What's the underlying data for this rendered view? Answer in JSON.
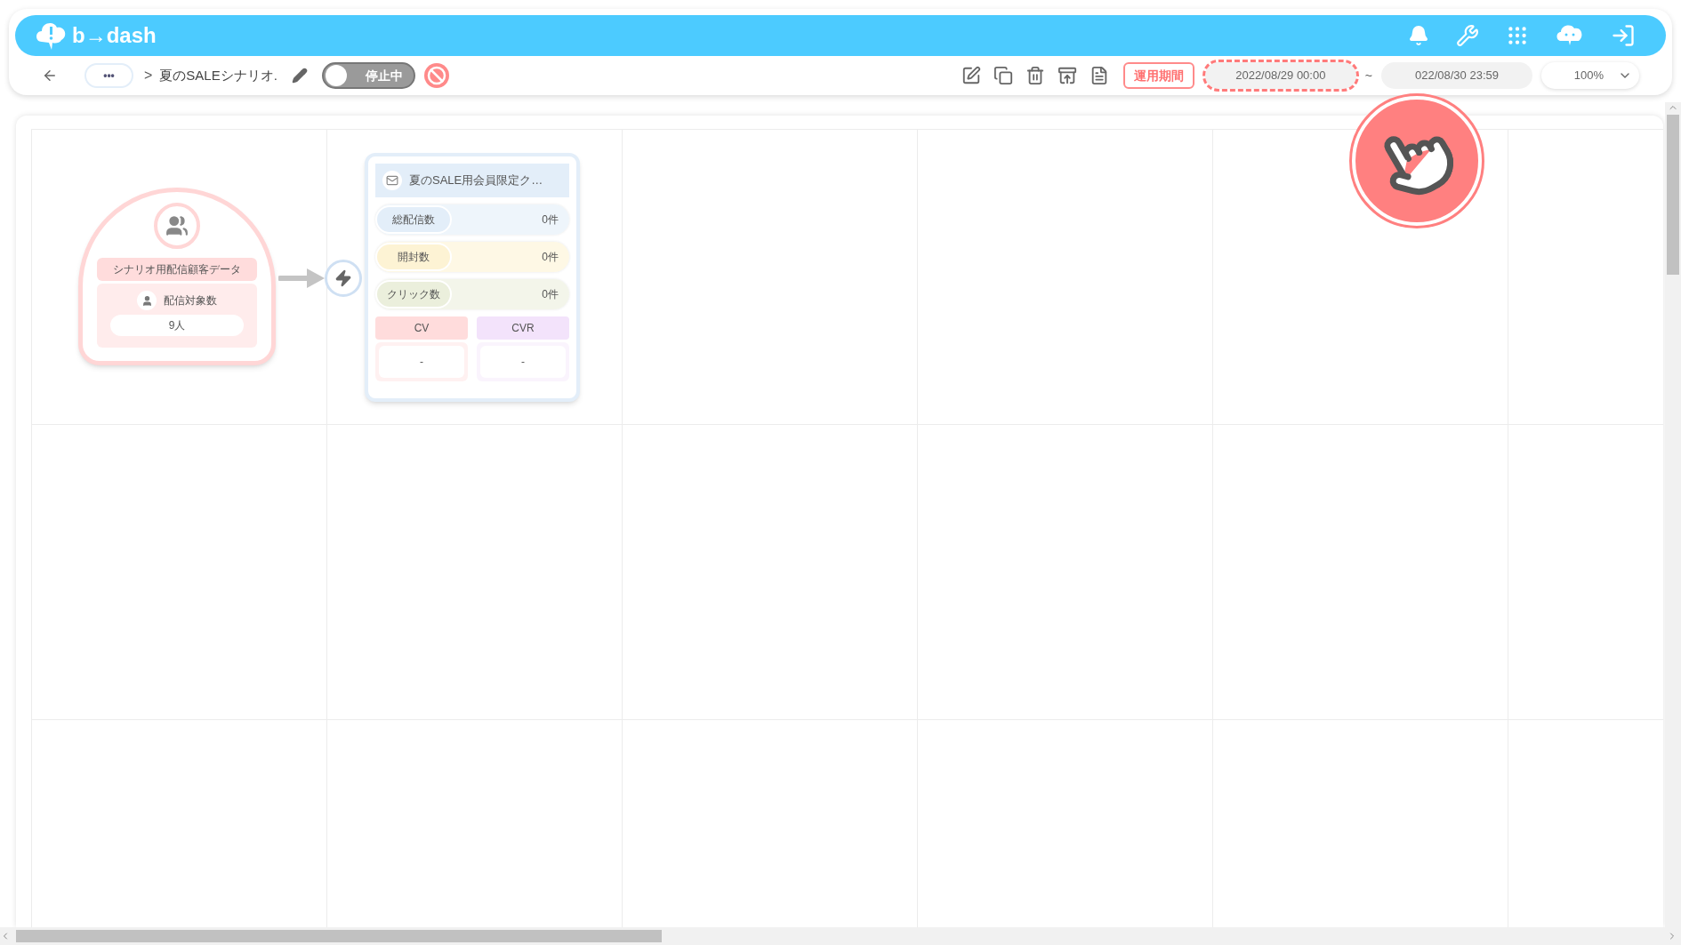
{
  "header": {
    "logo": "b→dash"
  },
  "toolbar": {
    "breadcrumb_more": "•••",
    "separator": ">",
    "title": "夏のSALEシナリオ.",
    "status_toggle": {
      "label": "停止中",
      "on": false
    },
    "period_label": "運用期間",
    "start": {
      "value": "2022/08/29 00:00",
      "highlighted": true
    },
    "range_separator": "~",
    "end": {
      "value": "022/08/30 23:59",
      "highlighted": false
    },
    "zoom": "100%"
  },
  "segment_node": {
    "title": "シナリオ用配信顧客データ",
    "count_label": "配信対象数",
    "count": "9人"
  },
  "mail_node": {
    "title": "夏のSALE用会員限定ク…",
    "metrics": [
      {
        "label": "総配信数",
        "value": "0件",
        "color": "#e3eef9"
      },
      {
        "label": "開封数",
        "value": "0件",
        "color": "#fdf3d4"
      },
      {
        "label": "クリック数",
        "value": "0件",
        "color": "#ebefdc"
      }
    ],
    "results": [
      {
        "label": "CV",
        "value": "-",
        "color": "#ffdcdc"
      },
      {
        "label": "CVR",
        "value": "-",
        "color": "#f3e3fb"
      }
    ]
  }
}
